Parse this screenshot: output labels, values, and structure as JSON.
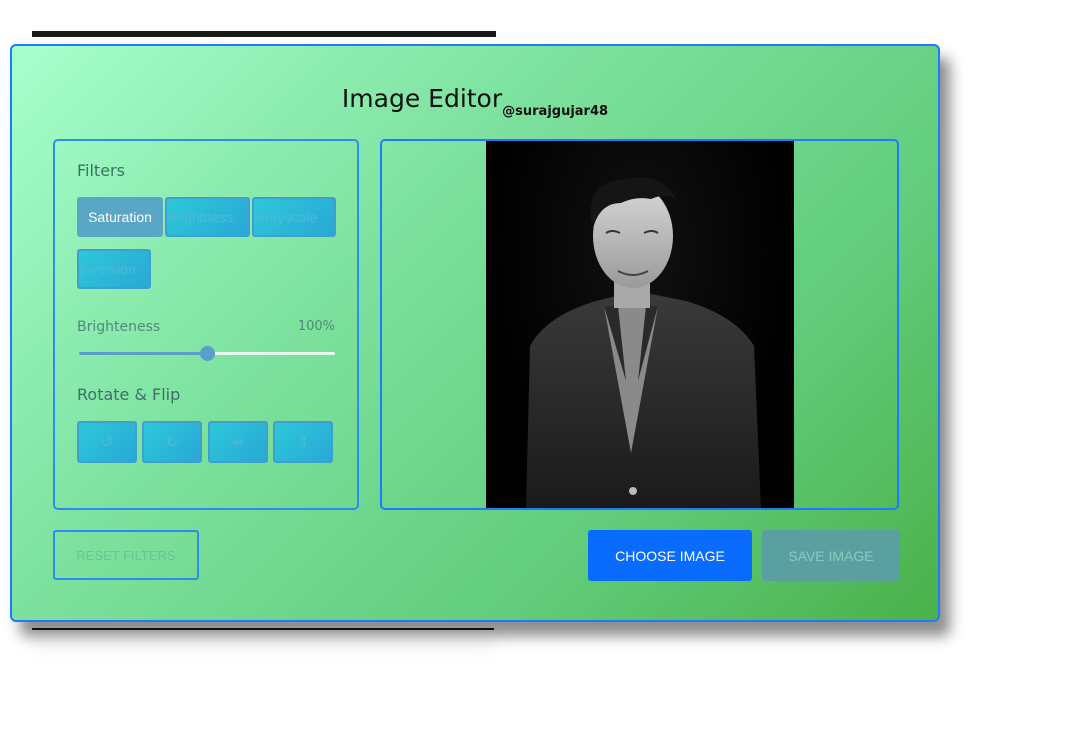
{
  "app": {
    "title": "Image Editor",
    "subtitle": "@surajgujar48"
  },
  "filters": {
    "section_label": "Filters",
    "buttons": [
      "Saturation",
      "Brightness",
      "Grayscale",
      "Inversion"
    ],
    "active": "Saturation"
  },
  "slider": {
    "label": "Brighteness",
    "value_text": "100%",
    "fill_fraction": 0.5
  },
  "rotate": {
    "section_label": "Rotate & Flip",
    "buttons": [
      {
        "icon": "rotate-left-icon",
        "glyph": "↺"
      },
      {
        "icon": "rotate-right-icon",
        "glyph": "↻"
      },
      {
        "icon": "flip-horizontal-icon",
        "glyph": "⇹"
      },
      {
        "icon": "flip-vertical-icon",
        "glyph": "⇕"
      }
    ]
  },
  "actions": {
    "reset": "RESET FILTERS",
    "choose": "CHOOSE IMAGE",
    "save": "SAVE IMAGE"
  },
  "colors": {
    "accent": "#0a6cff",
    "border": "#1e7bff",
    "button_gradient_start": "#2cc8d9",
    "active_filter": "#5aa6c6"
  }
}
